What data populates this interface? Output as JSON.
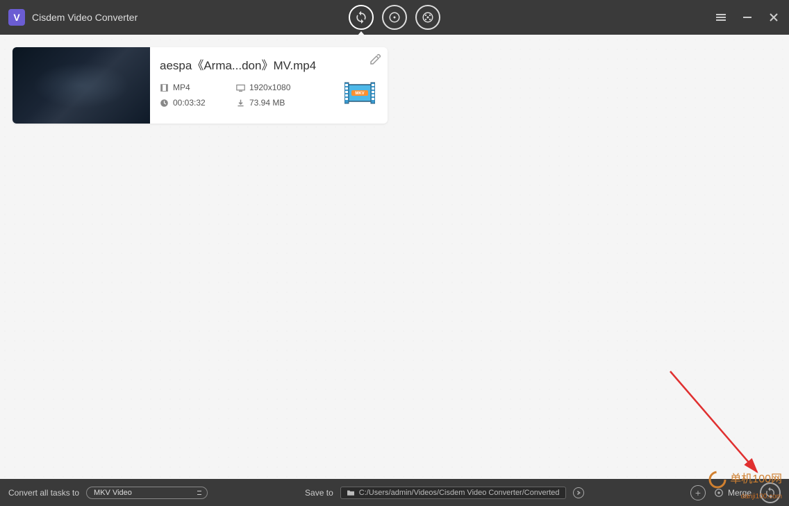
{
  "app": {
    "title": "Cisdem Video Converter"
  },
  "file": {
    "name": "aespa《Arma...don》MV.mp4",
    "format": "MP4",
    "resolution": "1920x1080",
    "duration": "00:03:32",
    "size": "73.94 MB",
    "output_format": "MKV"
  },
  "bottom": {
    "convert_label": "Convert all tasks to",
    "format_selected": "MKV Video",
    "save_label": "Save to",
    "save_path": "C:/Users/admin/Videos/Cisdem Video Converter/Converted",
    "merge_label": "Merge"
  },
  "watermark": {
    "text": "单机100网",
    "domain": "danji100.com"
  }
}
